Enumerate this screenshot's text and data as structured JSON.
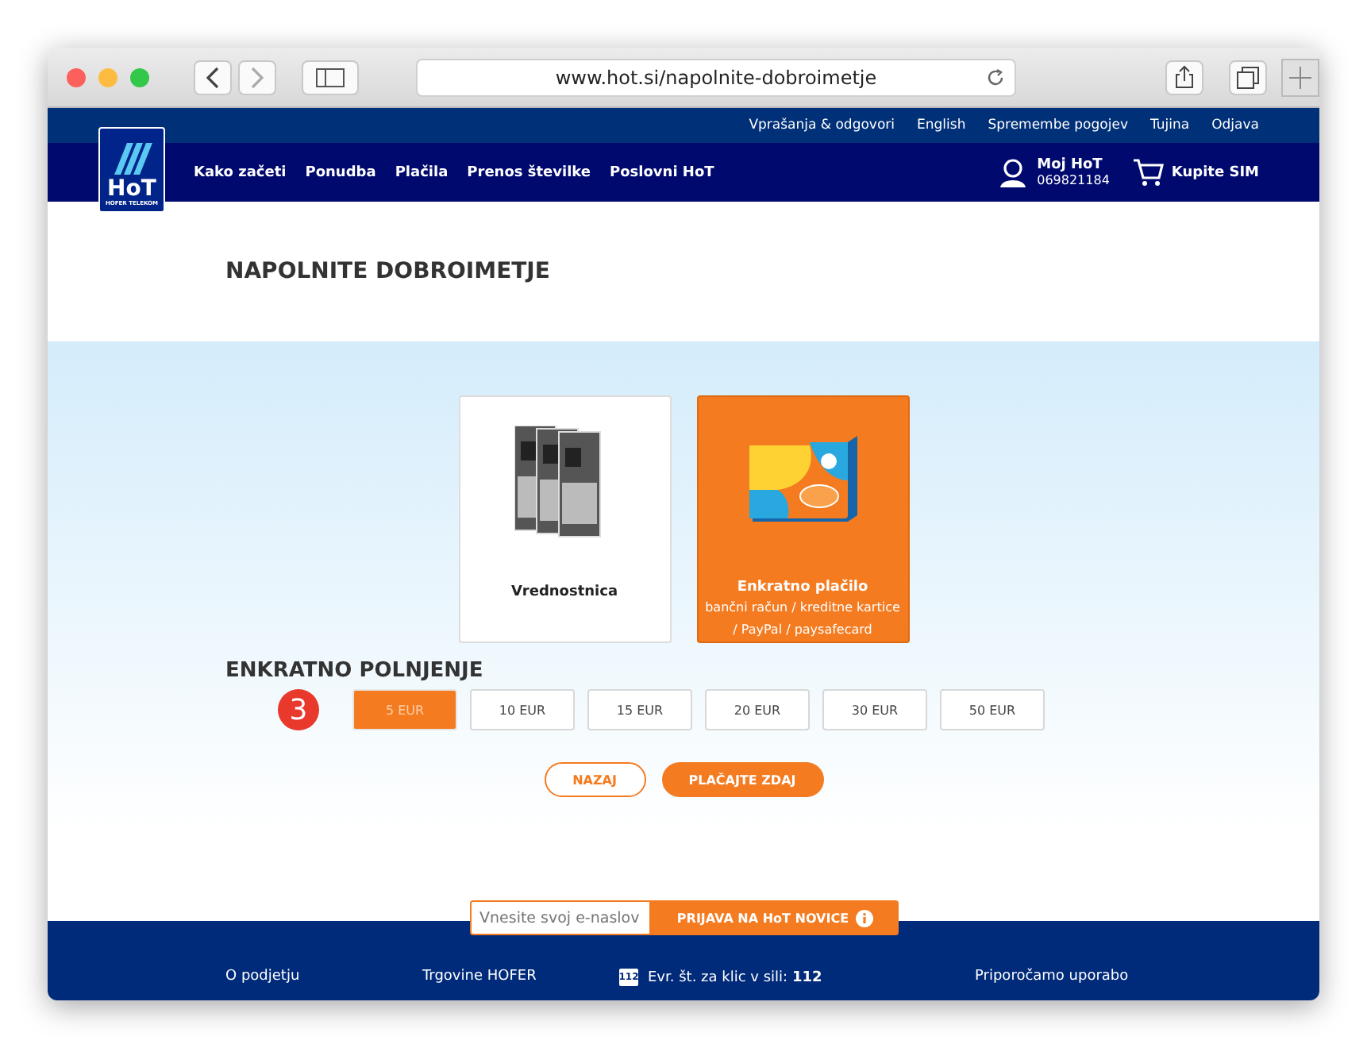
{
  "browser": {
    "url": "www.hot.si/napolnite-dobroimetje"
  },
  "logo": {
    "name": "HoT",
    "tagline": "HOFER TELEKOM"
  },
  "top_links": [
    "Vprašanja & odgovori",
    "English",
    "Spremembe pogojev",
    "Tujina",
    "Odjava"
  ],
  "nav": [
    "Kako začeti",
    "Ponudba",
    "Plačila",
    "Prenos številke",
    "Poslovni HoT"
  ],
  "account": {
    "label": "Moj HoT",
    "number": "069821184"
  },
  "cart": {
    "label": "Kupite SIM"
  },
  "page_title": "NAPOLNITE DOBROIMETJE",
  "payment_options": [
    {
      "kind": "voucher",
      "title": "Vrednostnica",
      "selected": false
    },
    {
      "kind": "card",
      "title": "Enkratno plačilo",
      "subtitle": "bančni račun / kreditne kartice / PayPal / paysafecard",
      "selected": true
    }
  ],
  "section_title": "ENKRATNO POLNJENJE",
  "step": "3",
  "amounts": [
    {
      "label": "5 EUR",
      "selected": true
    },
    {
      "label": "10 EUR",
      "selected": false
    },
    {
      "label": "15 EUR",
      "selected": false
    },
    {
      "label": "20 EUR",
      "selected": false
    },
    {
      "label": "30 EUR",
      "selected": false
    },
    {
      "label": "50 EUR",
      "selected": false
    }
  ],
  "buttons": {
    "back": "NAZAJ",
    "pay": "PLAČAJTE ZDAJ"
  },
  "newsletter": {
    "placeholder": "Vnesite svoj e-naslov",
    "button": "PRIJAVA NA HoT NOVICE"
  },
  "footer": {
    "links": [
      "O podjetju",
      "Trgovine HOFER"
    ],
    "emergency": {
      "icon_text": "112",
      "label": "Evr. št. za klic v sili:",
      "number": "112"
    },
    "app_note": "Priporočamo uporabo"
  }
}
